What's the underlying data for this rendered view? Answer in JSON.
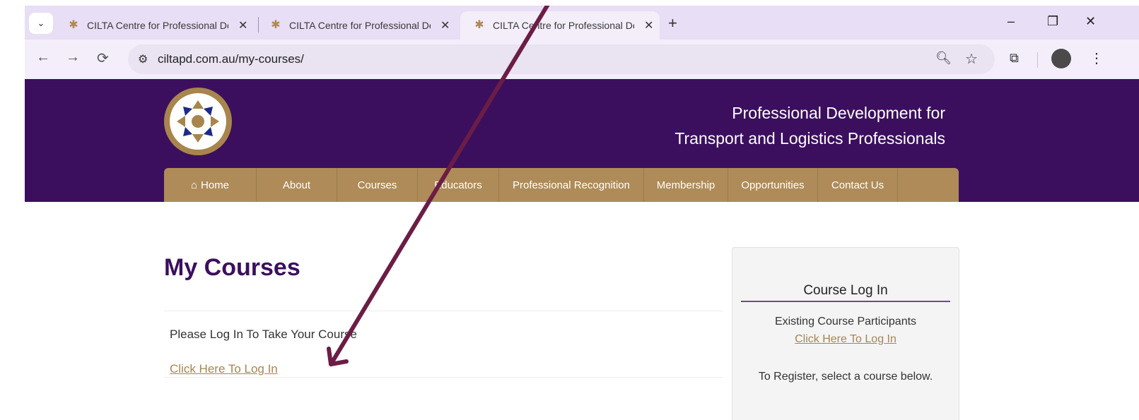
{
  "browser": {
    "tabs": [
      {
        "title": "CILTA Centre for Professional De",
        "close": "✕",
        "favicon": "cilta-favicon"
      },
      {
        "title": "CILTA Centre for Professional De",
        "close": "✕",
        "favicon": "cilta-favicon"
      },
      {
        "title": "CILTA Centre for Professional De",
        "close": "✕",
        "favicon": "cilta-favicon",
        "active": true
      }
    ],
    "new_tab": "+",
    "url": "ciltapd.com.au/my-courses/",
    "window_controls": {
      "minimize": "–",
      "restore": "❐",
      "close": "✕"
    }
  },
  "site": {
    "tagline_line1": "Professional Development for",
    "tagline_line2": "Transport and Logistics Professionals",
    "nav": [
      "Home",
      "About",
      "Courses",
      "Educators",
      "Professional Recognition",
      "Membership",
      "Opportunities",
      "Contact Us"
    ]
  },
  "main": {
    "title": "My Courses",
    "message": "Please Log In To Take Your Course",
    "login_link": "Click Here To Log In"
  },
  "sidebar": {
    "title": "Course Log In",
    "subtitle": "Existing Course Participants",
    "login_link": "Click Here To Log In",
    "register_text": "To Register, select a course below."
  },
  "colors": {
    "brand_purple": "#3b0f5e",
    "brand_gold": "#ae8b58",
    "annotation_arrow": "#6b1d45"
  }
}
